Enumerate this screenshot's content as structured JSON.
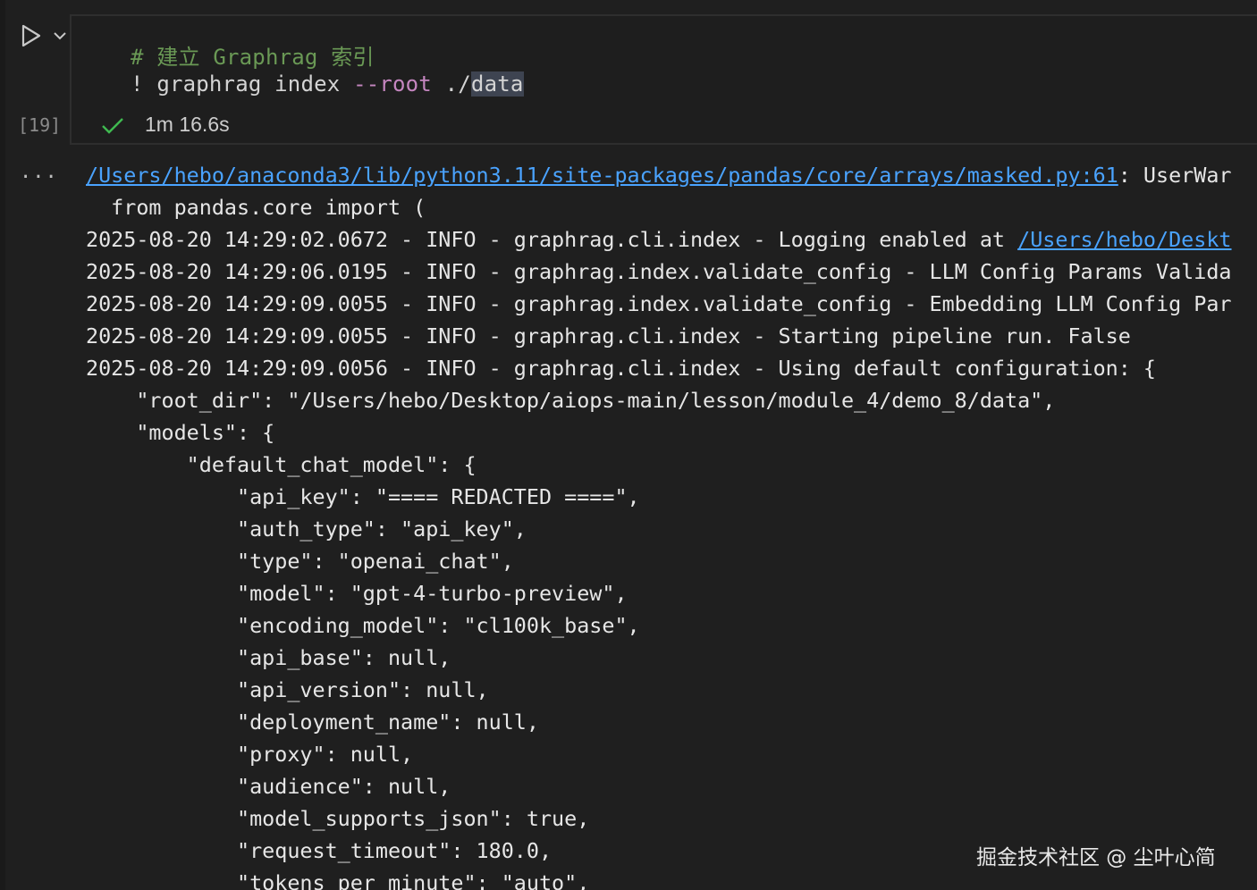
{
  "cell": {
    "execution_count": "[19]",
    "code": {
      "comment": "# 建立 Graphrag 索引",
      "bang": "! ",
      "command": "graphrag index ",
      "flag": "--root",
      "arg_prefix": " ./",
      "arg_selected": "data"
    },
    "status": {
      "icon": "check-icon",
      "duration": "1m 16.6s"
    },
    "output_menu": "···"
  },
  "output": {
    "warning_link": "/Users/hebo/anaconda3/lib/python3.11/site-packages/pandas/core/arrays/masked.py:61",
    "warning_text": ": UserWar",
    "lines": [
      "  from pandas.core import (",
      "2025-08-20 14:29:02.0672 - INFO - graphrag.cli.index - Logging enabled at ",
      "2025-08-20 14:29:06.0195 - INFO - graphrag.index.validate_config - LLM Config Params Valida",
      "2025-08-20 14:29:09.0055 - INFO - graphrag.index.validate_config - Embedding LLM Config Par",
      "2025-08-20 14:29:09.0055 - INFO - graphrag.cli.index - Starting pipeline run. False",
      "2025-08-20 14:29:09.0056 - INFO - graphrag.cli.index - Using default configuration: {",
      "    \"root_dir\": \"/Users/hebo/Desktop/aiops-main/lesson/module_4/demo_8/data\",",
      "    \"models\": {",
      "        \"default_chat_model\": {",
      "            \"api_key\": \"==== REDACTED ====\",",
      "            \"auth_type\": \"api_key\",",
      "            \"type\": \"openai_chat\",",
      "            \"model\": \"gpt-4-turbo-preview\",",
      "            \"encoding_model\": \"cl100k_base\",",
      "            \"api_base\": null,",
      "            \"api_version\": null,",
      "            \"deployment_name\": null,",
      "            \"proxy\": null,",
      "            \"audience\": null,",
      "            \"model_supports_json\": true,",
      "            \"request_timeout\": 180.0,",
      "            \"tokens_per_minute\": \"auto\","
    ],
    "logging_link": "/Users/hebo/Deskt"
  },
  "watermark": "掘金技术社区 @ 尘叶心简",
  "colors": {
    "background": "#1f1f1f",
    "comment": "#6a9955",
    "flag": "#c586c0",
    "link": "#4aa3ff",
    "check": "#3fb950"
  }
}
